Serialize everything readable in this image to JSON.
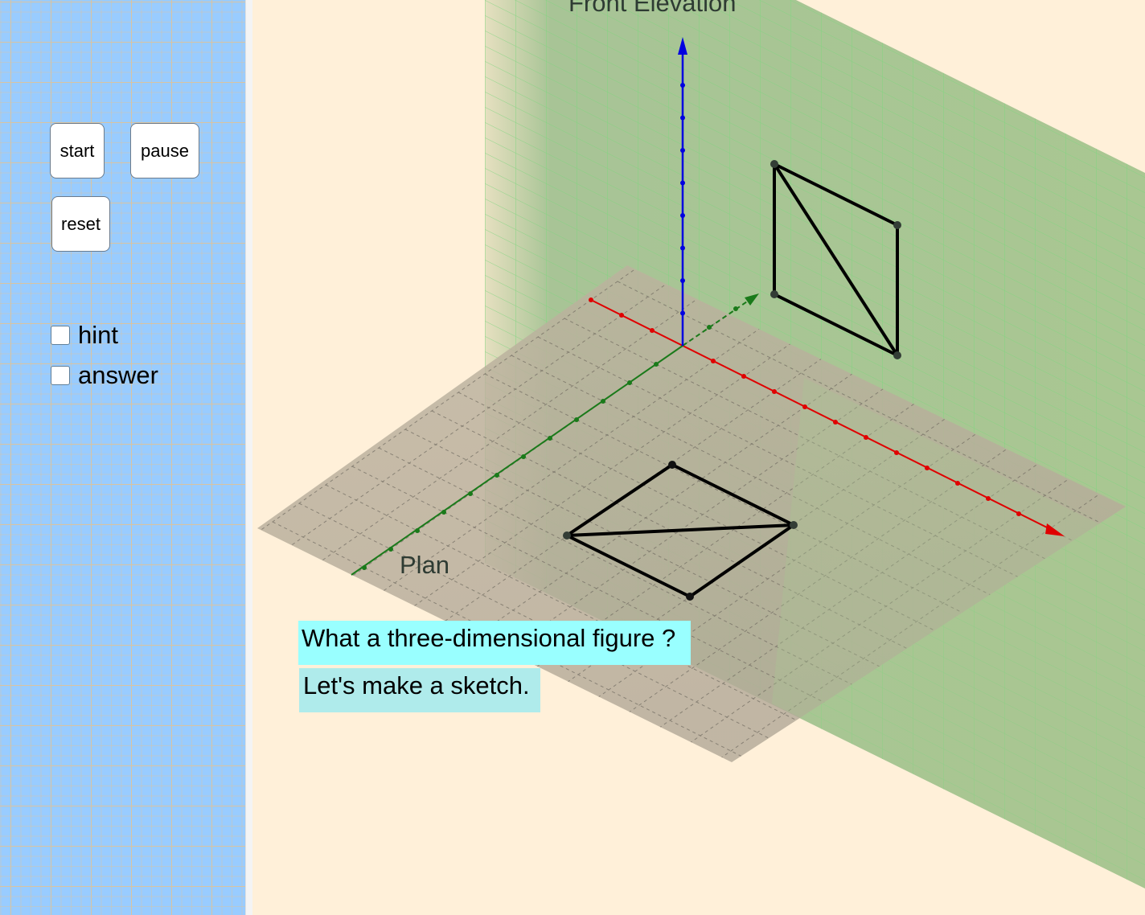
{
  "sidebar": {
    "buttons": {
      "start": "start",
      "pause": "pause",
      "reset": "reset"
    },
    "checkboxes": [
      {
        "label": "hint",
        "checked": false
      },
      {
        "label": "answer",
        "checked": false
      }
    ]
  },
  "view3d": {
    "labels": {
      "front_elevation": "Front Elevation",
      "plan": "Plan"
    },
    "axis_colors": {
      "x": "#e00000",
      "y": "#1a7a1a",
      "z": "#0000e0"
    },
    "plane_colors": {
      "vertical": "#9fc78f",
      "floor": "#b4ab9c"
    }
  },
  "text_boxes": {
    "question": "What a three-dimensional figure ?",
    "prompt": "Let's make a sketch."
  },
  "colors": {
    "sidebar_bg": "#99ccff",
    "canvas_bg": "#fff0d9",
    "question_bg": "#99ffff",
    "prompt_bg": "#afebeb"
  }
}
